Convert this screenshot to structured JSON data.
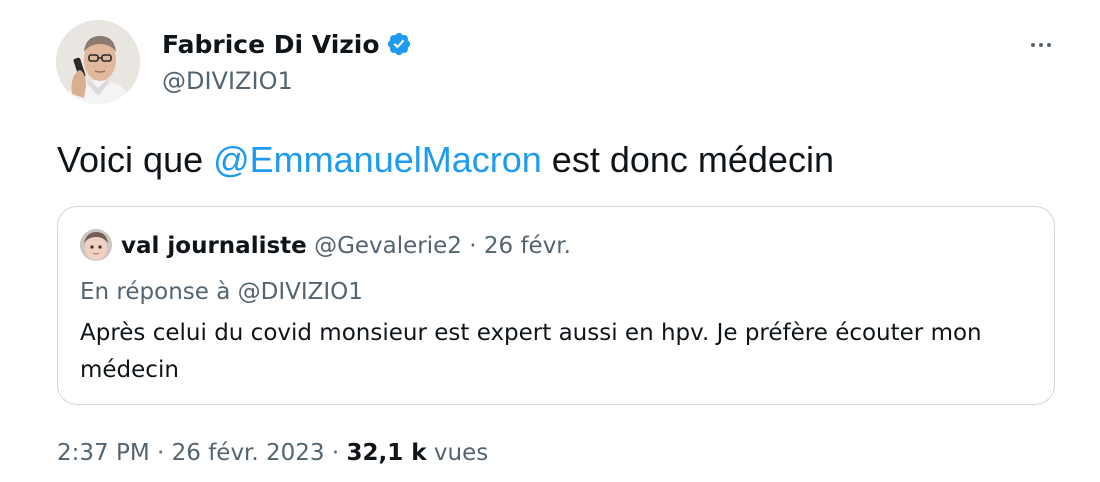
{
  "author": {
    "name": "Fabrice Di Vizio",
    "handle": "@DIVIZIO1"
  },
  "tweet": {
    "text_before": "Voici que ",
    "mention": "@EmmanuelMacron",
    "text_after": " est donc médecin"
  },
  "quote": {
    "name": "val journaliste",
    "handle": "@Gevalerie2",
    "separator": "·",
    "date": "26 févr.",
    "reply_label": "En réponse à",
    "reply_to": "@DIVIZIO1",
    "text": "Après celui du covid monsieur est expert aussi en hpv. Je préfère écouter mon médecin"
  },
  "meta": {
    "time": "2:37 PM",
    "separator": "·",
    "date": "26 févr. 2023",
    "views_count": "32,1 k",
    "views_label": "vues"
  },
  "colors": {
    "accent": "#1d9bf0",
    "secondary_text": "#536471",
    "primary_text": "#0f1419",
    "border": "#cfd9de"
  },
  "icons": {
    "verified": "verified-badge-icon",
    "more": "more-options-icon"
  }
}
